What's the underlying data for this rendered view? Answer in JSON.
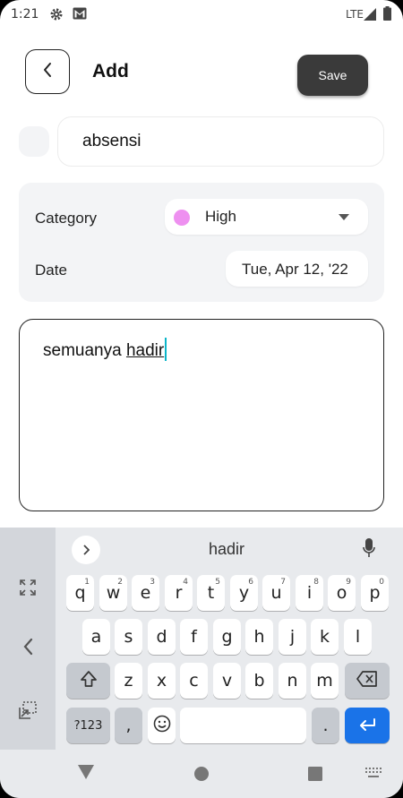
{
  "status_bar": {
    "time": "1:21",
    "network": "LTE",
    "icons": [
      "settings-icon",
      "gmail-icon",
      "signal-icon",
      "battery-icon"
    ]
  },
  "header": {
    "title": "Add",
    "save_label": "Save",
    "back_icon": "chevron-left-icon"
  },
  "task": {
    "name": "absensi"
  },
  "properties": {
    "category_label": "Category",
    "category_value": "High",
    "category_color": "#ee90f0",
    "date_label": "Date",
    "date_value": "Tue, Apr 12, '22"
  },
  "note": {
    "text_before": "semuanya ",
    "text_composing": "hadir"
  },
  "keyboard": {
    "suggestion": "hadir",
    "row1": [
      "q",
      "w",
      "e",
      "r",
      "t",
      "y",
      "u",
      "i",
      "o",
      "p"
    ],
    "row1_hints": [
      "1",
      "2",
      "3",
      "4",
      "5",
      "6",
      "7",
      "8",
      "9",
      "0"
    ],
    "row2": [
      "a",
      "s",
      "d",
      "f",
      "g",
      "h",
      "j",
      "k",
      "l"
    ],
    "row3": [
      "z",
      "x",
      "c",
      "v",
      "b",
      "n",
      "m"
    ],
    "symbols_label": "?123",
    "comma": ",",
    "period": "."
  },
  "colors": {
    "accent": "#0bb5c9",
    "save_bg": "#3a3a3a",
    "enter_key": "#1a73e8"
  }
}
